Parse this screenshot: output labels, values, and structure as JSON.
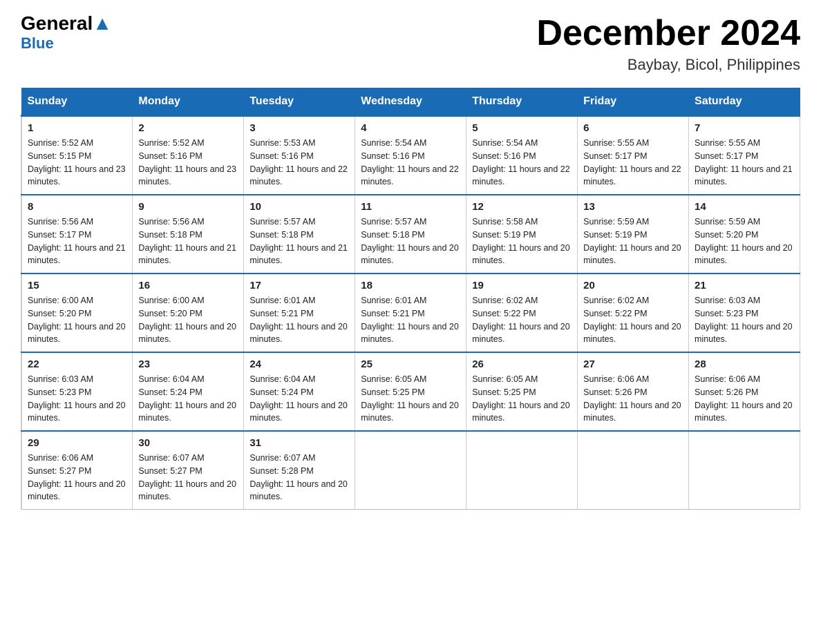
{
  "header": {
    "logo_general": "General",
    "logo_blue": "Blue",
    "main_title": "December 2024",
    "subtitle": "Baybay, Bicol, Philippines"
  },
  "days_of_week": [
    "Sunday",
    "Monday",
    "Tuesday",
    "Wednesday",
    "Thursday",
    "Friday",
    "Saturday"
  ],
  "weeks": [
    [
      {
        "day": "1",
        "sunrise": "5:52 AM",
        "sunset": "5:15 PM",
        "daylight": "11 hours and 23 minutes."
      },
      {
        "day": "2",
        "sunrise": "5:52 AM",
        "sunset": "5:16 PM",
        "daylight": "11 hours and 23 minutes."
      },
      {
        "day": "3",
        "sunrise": "5:53 AM",
        "sunset": "5:16 PM",
        "daylight": "11 hours and 22 minutes."
      },
      {
        "day": "4",
        "sunrise": "5:54 AM",
        "sunset": "5:16 PM",
        "daylight": "11 hours and 22 minutes."
      },
      {
        "day": "5",
        "sunrise": "5:54 AM",
        "sunset": "5:16 PM",
        "daylight": "11 hours and 22 minutes."
      },
      {
        "day": "6",
        "sunrise": "5:55 AM",
        "sunset": "5:17 PM",
        "daylight": "11 hours and 22 minutes."
      },
      {
        "day": "7",
        "sunrise": "5:55 AM",
        "sunset": "5:17 PM",
        "daylight": "11 hours and 21 minutes."
      }
    ],
    [
      {
        "day": "8",
        "sunrise": "5:56 AM",
        "sunset": "5:17 PM",
        "daylight": "11 hours and 21 minutes."
      },
      {
        "day": "9",
        "sunrise": "5:56 AM",
        "sunset": "5:18 PM",
        "daylight": "11 hours and 21 minutes."
      },
      {
        "day": "10",
        "sunrise": "5:57 AM",
        "sunset": "5:18 PM",
        "daylight": "11 hours and 21 minutes."
      },
      {
        "day": "11",
        "sunrise": "5:57 AM",
        "sunset": "5:18 PM",
        "daylight": "11 hours and 20 minutes."
      },
      {
        "day": "12",
        "sunrise": "5:58 AM",
        "sunset": "5:19 PM",
        "daylight": "11 hours and 20 minutes."
      },
      {
        "day": "13",
        "sunrise": "5:59 AM",
        "sunset": "5:19 PM",
        "daylight": "11 hours and 20 minutes."
      },
      {
        "day": "14",
        "sunrise": "5:59 AM",
        "sunset": "5:20 PM",
        "daylight": "11 hours and 20 minutes."
      }
    ],
    [
      {
        "day": "15",
        "sunrise": "6:00 AM",
        "sunset": "5:20 PM",
        "daylight": "11 hours and 20 minutes."
      },
      {
        "day": "16",
        "sunrise": "6:00 AM",
        "sunset": "5:20 PM",
        "daylight": "11 hours and 20 minutes."
      },
      {
        "day": "17",
        "sunrise": "6:01 AM",
        "sunset": "5:21 PM",
        "daylight": "11 hours and 20 minutes."
      },
      {
        "day": "18",
        "sunrise": "6:01 AM",
        "sunset": "5:21 PM",
        "daylight": "11 hours and 20 minutes."
      },
      {
        "day": "19",
        "sunrise": "6:02 AM",
        "sunset": "5:22 PM",
        "daylight": "11 hours and 20 minutes."
      },
      {
        "day": "20",
        "sunrise": "6:02 AM",
        "sunset": "5:22 PM",
        "daylight": "11 hours and 20 minutes."
      },
      {
        "day": "21",
        "sunrise": "6:03 AM",
        "sunset": "5:23 PM",
        "daylight": "11 hours and 20 minutes."
      }
    ],
    [
      {
        "day": "22",
        "sunrise": "6:03 AM",
        "sunset": "5:23 PM",
        "daylight": "11 hours and 20 minutes."
      },
      {
        "day": "23",
        "sunrise": "6:04 AM",
        "sunset": "5:24 PM",
        "daylight": "11 hours and 20 minutes."
      },
      {
        "day": "24",
        "sunrise": "6:04 AM",
        "sunset": "5:24 PM",
        "daylight": "11 hours and 20 minutes."
      },
      {
        "day": "25",
        "sunrise": "6:05 AM",
        "sunset": "5:25 PM",
        "daylight": "11 hours and 20 minutes."
      },
      {
        "day": "26",
        "sunrise": "6:05 AM",
        "sunset": "5:25 PM",
        "daylight": "11 hours and 20 minutes."
      },
      {
        "day": "27",
        "sunrise": "6:06 AM",
        "sunset": "5:26 PM",
        "daylight": "11 hours and 20 minutes."
      },
      {
        "day": "28",
        "sunrise": "6:06 AM",
        "sunset": "5:26 PM",
        "daylight": "11 hours and 20 minutes."
      }
    ],
    [
      {
        "day": "29",
        "sunrise": "6:06 AM",
        "sunset": "5:27 PM",
        "daylight": "11 hours and 20 minutes."
      },
      {
        "day": "30",
        "sunrise": "6:07 AM",
        "sunset": "5:27 PM",
        "daylight": "11 hours and 20 minutes."
      },
      {
        "day": "31",
        "sunrise": "6:07 AM",
        "sunset": "5:28 PM",
        "daylight": "11 hours and 20 minutes."
      },
      null,
      null,
      null,
      null
    ]
  ]
}
